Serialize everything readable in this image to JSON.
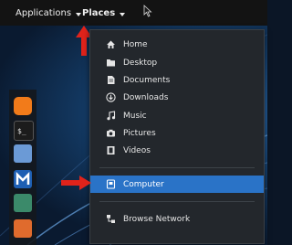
{
  "topbar": {
    "applications_label": "Applications",
    "places_label": "Places"
  },
  "places_menu": {
    "items": [
      {
        "label": "Home",
        "icon": "home-icon"
      },
      {
        "label": "Desktop",
        "icon": "folder-icon"
      },
      {
        "label": "Documents",
        "icon": "document-icon"
      },
      {
        "label": "Downloads",
        "icon": "download-icon"
      },
      {
        "label": "Music",
        "icon": "music-icon"
      },
      {
        "label": "Pictures",
        "icon": "camera-icon"
      },
      {
        "label": "Videos",
        "icon": "film-icon"
      }
    ],
    "computer_label": "Computer",
    "browse_network_label": "Browse Network"
  },
  "dock": {
    "items": [
      "firefox-icon",
      "terminal-icon",
      "files-icon",
      "metasploit-icon",
      "user-icon",
      "burp-icon"
    ]
  },
  "colors": {
    "topbar": "#131313",
    "menu_bg": "#23272c",
    "highlight": "#2a73c7",
    "annotation_arrow": "#e0231b"
  }
}
